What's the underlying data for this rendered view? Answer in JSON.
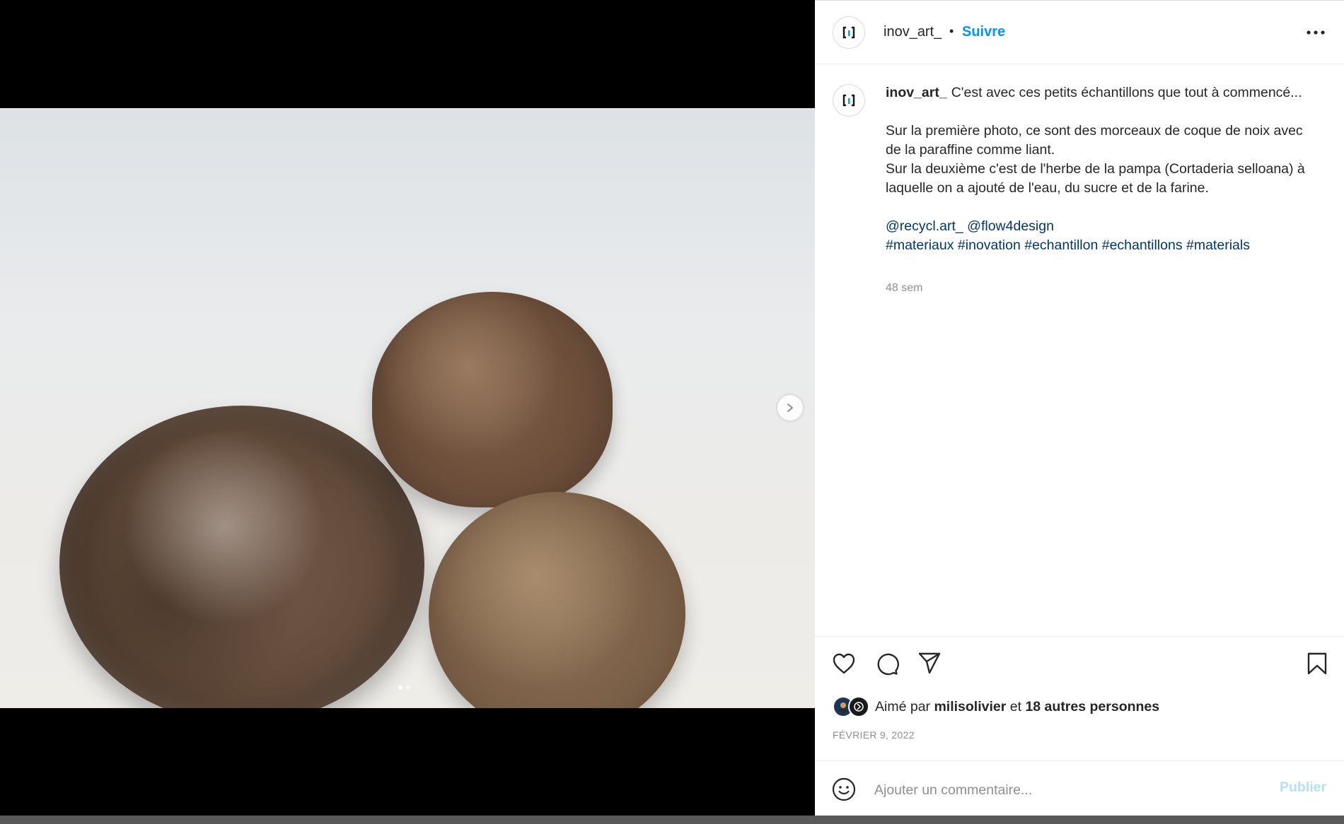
{
  "post": {
    "username": "inov_art_",
    "separator": "•",
    "follow_label": "Suivre"
  },
  "caption": {
    "username": "inov_art_",
    "line1": "C'est avec ces petits échantillons que tout à commencé...",
    "line2": "Sur la première photo, ce sont des morceaux de coque de noix avec de la paraffine comme liant.",
    "line3": "Sur la deuxième c'est de l'herbe de la pampa (Cortaderia selloana) à laquelle on a ajouté de l'eau, du sucre et de la farine.",
    "mentions": [
      "@recycl.art_",
      "@flow4design"
    ],
    "hashtags": [
      "#materiaux",
      "#inovation",
      "#echantillon",
      "#echantillons",
      "#materials"
    ],
    "age": "48 sem"
  },
  "likes": {
    "prefix": "Aimé par",
    "user": "milisolivier",
    "conjunction": "et",
    "others": "18 autres personnes"
  },
  "date": "FÉVRIER 9, 2022",
  "comment": {
    "placeholder": "Ajouter un commentaire...",
    "publish_label": "Publier"
  },
  "carousel": {
    "count": 2,
    "active_index": 0
  },
  "colors": {
    "link_blue": "#0095f6",
    "tag_blue": "#00376b",
    "publish_disabled": "#b2dffc",
    "muted": "#8e8e8e"
  },
  "icons": [
    "logo-icon",
    "more-icon",
    "chevron-right-icon",
    "heart-icon",
    "comment-icon",
    "share-icon",
    "bookmark-icon",
    "emoji-icon"
  ]
}
